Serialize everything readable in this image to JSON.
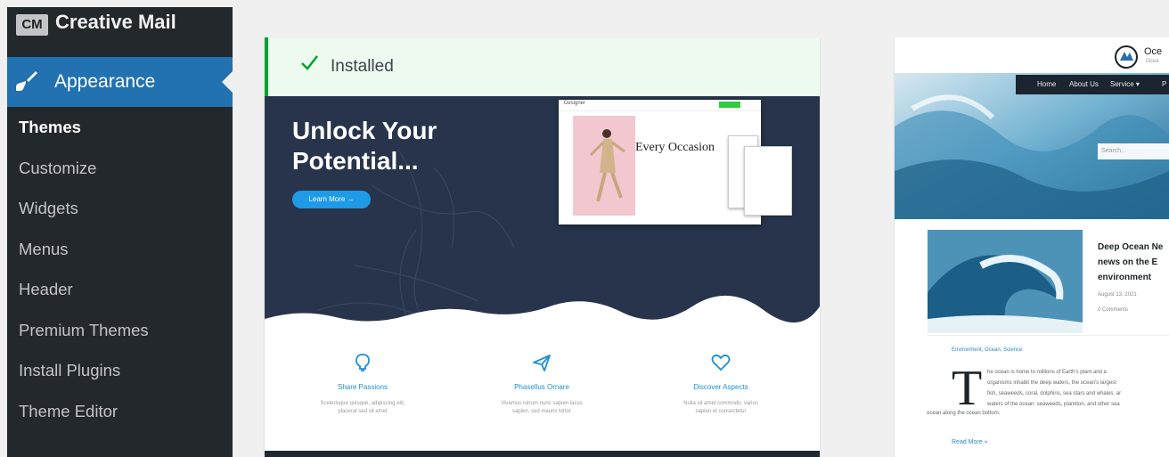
{
  "sidebar": {
    "plugin_badge": "CM",
    "plugin_label": "Creative Mail",
    "active_menu": "Appearance",
    "submenu": [
      "Themes",
      "Customize",
      "Widgets",
      "Menus",
      "Header",
      "Premium Themes",
      "Install Plugins",
      "Theme Editor"
    ],
    "accent_color": "#2271b1",
    "icons": {
      "brush": "paintbrush-icon"
    }
  },
  "theme_card_1": {
    "status_label": "Installed",
    "status_icon": "checkmark-icon",
    "hero": {
      "headline_line1": "Unlock Your",
      "headline_line2": "Potential...",
      "cta_label": "Learn More →",
      "mock_caption": "Every Occasion"
    },
    "features": [
      {
        "icon": "lightbulb-icon",
        "title": "Share Passions",
        "desc": "Scelerisque quisque, adipiscing elit,\nplacerat sed sit amet"
      },
      {
        "icon": "paper-plane-icon",
        "title": "Phasellus Ornare",
        "desc": "Vivamus rutrum nunc sapien lacus\nsapien, sed mauris tortor"
      },
      {
        "icon": "heart-icon",
        "title": "Discover Aspects",
        "desc": "Nulla sit amet commodo, varius\nsapien et consectetur"
      }
    ]
  },
  "theme_card_2": {
    "brand": "Oce",
    "nav_items": [
      "Home",
      "About Us",
      "Service ▾",
      "P"
    ],
    "search_placeholder": "Search...",
    "article_title_1": "Deep Ocean Ne",
    "article_title_2": "news on the E",
    "article_title_3": "environment",
    "date": "August 13, 2021",
    "comments": "0 Comments",
    "categories": "Environment, Ocean, Science",
    "dropcap": "T",
    "body_lines": [
      "he ocean is home to millions of Earth's plant and a",
      "organisms inhabit the deep waters, the ocean's largest",
      "fish, seaweeds, coral, dolphins, sea stars and whales, ar",
      "waters of the ocean: seaweeds, plankton, and other sea"
    ],
    "body_last": "ocean along the ocean bottom.",
    "read_more": "Read More »"
  }
}
